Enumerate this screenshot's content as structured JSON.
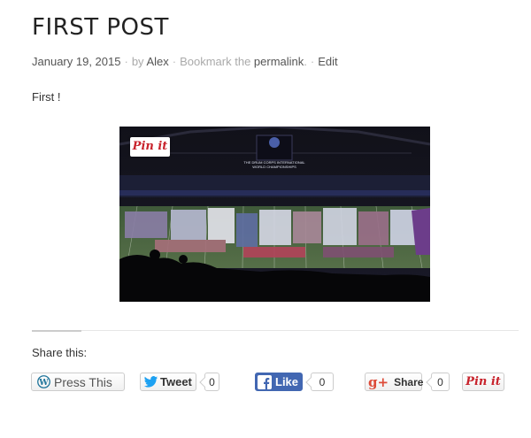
{
  "post": {
    "title": "FIRST POST",
    "date": "January 19, 2015",
    "by": "by",
    "author": "Alex",
    "bookmark_prefix": "Bookmark the",
    "permalink": "permalink",
    "permalink_period": ".",
    "edit": "Edit",
    "content": "First !"
  },
  "image": {
    "pin_label": "Pin it",
    "banner_line1": "THE DRUM CORPS INTERNATIONAL",
    "banner_line2": "WORLD CHAMPIONSHIPS"
  },
  "share": {
    "title": "Share this:",
    "press_this": "Press This",
    "tweet": "Tweet",
    "tweet_count": "0",
    "like": "Like",
    "like_count": "0",
    "gplus": "Share",
    "gplus_count": "0",
    "pinit": "Pin it"
  },
  "colors": {
    "pinterest_red": "#c8232c",
    "facebook_blue": "#4267b2",
    "twitter_blue": "#1da1f2",
    "gplus_red": "#dd4b39"
  }
}
